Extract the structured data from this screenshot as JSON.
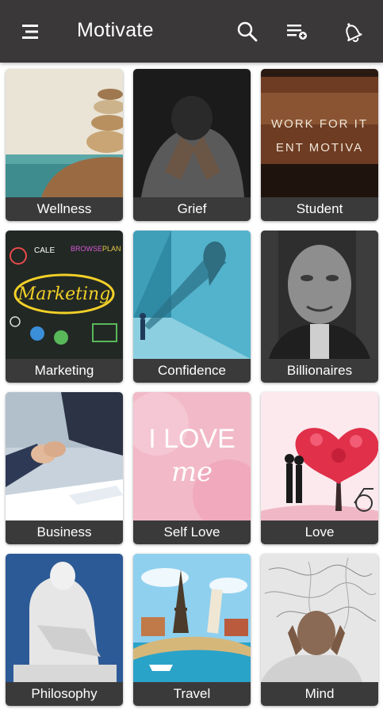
{
  "app": {
    "title": "Motivate"
  },
  "header_icons": [
    "menu-icon",
    "search-icon",
    "playlist-add-icon",
    "bell-icon"
  ],
  "categories": [
    {
      "label": "Wellness"
    },
    {
      "label": "Grief"
    },
    {
      "label": "Student",
      "image_text": [
        "WORK FOR IT",
        "ENT MOTIVA"
      ]
    },
    {
      "label": "Marketing",
      "image_text": [
        "Marketing",
        "CALE",
        "BROWSE",
        "PLAN"
      ]
    },
    {
      "label": "Confidence"
    },
    {
      "label": "Billionaires"
    },
    {
      "label": "Business"
    },
    {
      "label": "Self Love",
      "image_text": [
        "I LOVE",
        "me"
      ]
    },
    {
      "label": "Love"
    },
    {
      "label": "Philosophy"
    },
    {
      "label": "Travel"
    },
    {
      "label": "Mind"
    }
  ],
  "colors": {
    "appbar": "#3a3838",
    "label_bar": "#3b3a3a",
    "text": "#ffffff"
  }
}
